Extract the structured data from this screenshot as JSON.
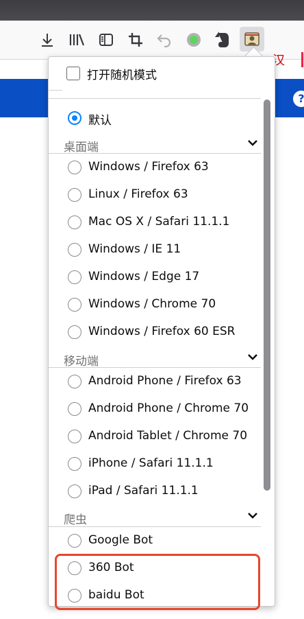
{
  "toolbar": {
    "icons": [
      "download-icon",
      "library-icon",
      "sidebar-icon",
      "crop-icon",
      "undo-icon",
      "record-icon",
      "evernote-icon",
      "user-agent-switcher-icon"
    ],
    "hanzi_label": "汉",
    "help_label": "?"
  },
  "panel": {
    "random_mode_label": "打开随机模式",
    "default_option": "默认",
    "sections": [
      {
        "title": "桌面端",
        "options": [
          "Windows / Firefox 63",
          "Linux / Firefox 63",
          "Mac OS X / Safari 11.1.1",
          "Windows / IE 11",
          "Windows / Edge 17",
          "Windows / Chrome 70",
          "Windows / Firefox 60 ESR"
        ]
      },
      {
        "title": "移动端",
        "options": [
          "Android Phone / Firefox 63",
          "Android Phone / Chrome 70",
          "Android Tablet / Chrome 70",
          "iPhone / Safari 11.1.1",
          "iPad / Safari 11.1.1"
        ]
      },
      {
        "title": "爬虫",
        "options": [
          "Google Bot",
          "360 Bot",
          "baidu Bot"
        ]
      }
    ]
  },
  "colors": {
    "accent": "#0a84ff",
    "page_bar": "#0a4fc4",
    "highlight": "#e8452c"
  }
}
